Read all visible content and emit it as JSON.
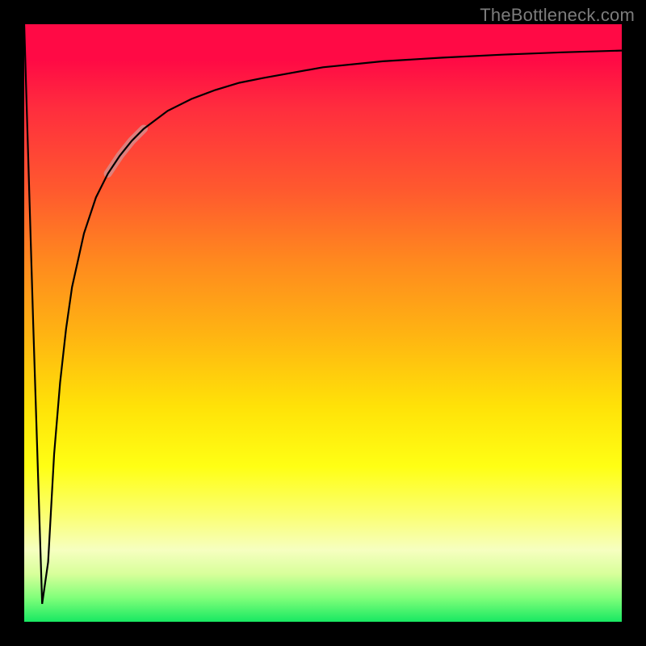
{
  "attribution": "TheBottleneck.com",
  "chart_data": {
    "type": "line",
    "title": "",
    "xlabel": "",
    "ylabel": "",
    "xlim": [
      0,
      100
    ],
    "ylim": [
      0,
      100
    ],
    "grid": false,
    "legend": false,
    "series": [
      {
        "name": "curve",
        "x": [
          0,
          1.5,
          3,
          4,
          5,
          6,
          7,
          8,
          10,
          12,
          14,
          16,
          18,
          20,
          24,
          28,
          32,
          36,
          40,
          50,
          60,
          70,
          80,
          90,
          100
        ],
        "y": [
          100,
          50,
          3,
          10,
          28,
          40,
          49,
          56,
          65,
          71,
          75,
          78,
          80.5,
          82.5,
          85.5,
          87.5,
          89,
          90.2,
          91,
          92.8,
          93.8,
          94.4,
          94.9,
          95.3,
          95.6
        ]
      }
    ],
    "highlight_segment": {
      "series": "curve",
      "x_start": 14,
      "x_end": 22,
      "color": "#d88a88",
      "width": 10
    }
  }
}
